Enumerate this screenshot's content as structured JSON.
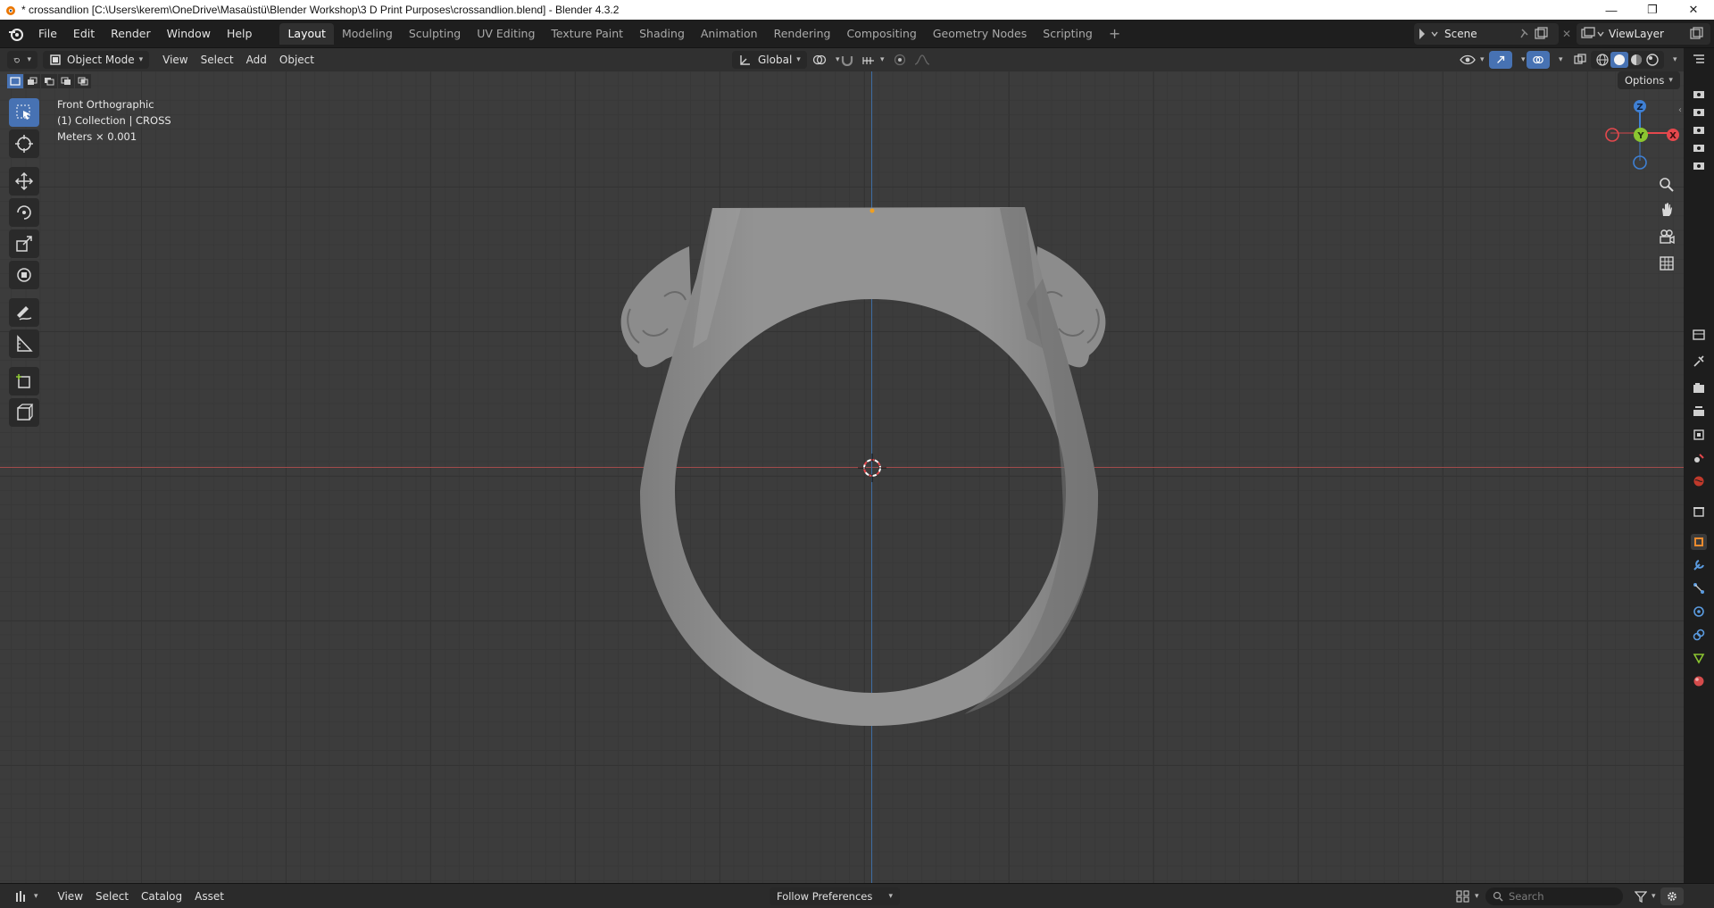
{
  "window": {
    "title": "* crossandlion [C:\\Users\\kerem\\OneDrive\\Masaüstü\\Blender Workshop\\3 D Print Purposes\\crossandlion.blend] - Blender 4.3.2",
    "minimize": "—",
    "maximize": "❐",
    "close": "✕"
  },
  "menu": [
    "File",
    "Edit",
    "Render",
    "Window",
    "Help"
  ],
  "workspaces": {
    "tabs": [
      "Layout",
      "Modeling",
      "Sculpting",
      "UV Editing",
      "Texture Paint",
      "Shading",
      "Animation",
      "Rendering",
      "Compositing",
      "Geometry Nodes",
      "Scripting"
    ],
    "active": "Layout",
    "add": "+"
  },
  "scene": {
    "name": "Scene"
  },
  "view_layer": {
    "name": "ViewLayer"
  },
  "viewport_header": {
    "mode": "Object Mode",
    "menus": [
      "View",
      "Select",
      "Add",
      "Object"
    ],
    "orientation": "Global"
  },
  "viewport": {
    "view_name": "Front Orthographic",
    "collection": "(1) Collection | CROSS",
    "units": "Meters × 0.001",
    "options": "Options"
  },
  "gizmo": {
    "z": "Z",
    "y": "Y",
    "x": "X"
  },
  "bottom": {
    "menus": [
      "View",
      "Select",
      "Catalog",
      "Asset"
    ],
    "library": "Follow Preferences",
    "search_placeholder": "Search"
  },
  "colors": {
    "accent": "#4772b3",
    "x_axis": "#e5484d",
    "y_axis": "#8bc530",
    "z_axis": "#3f80d4",
    "model": "#8f8f8f"
  }
}
